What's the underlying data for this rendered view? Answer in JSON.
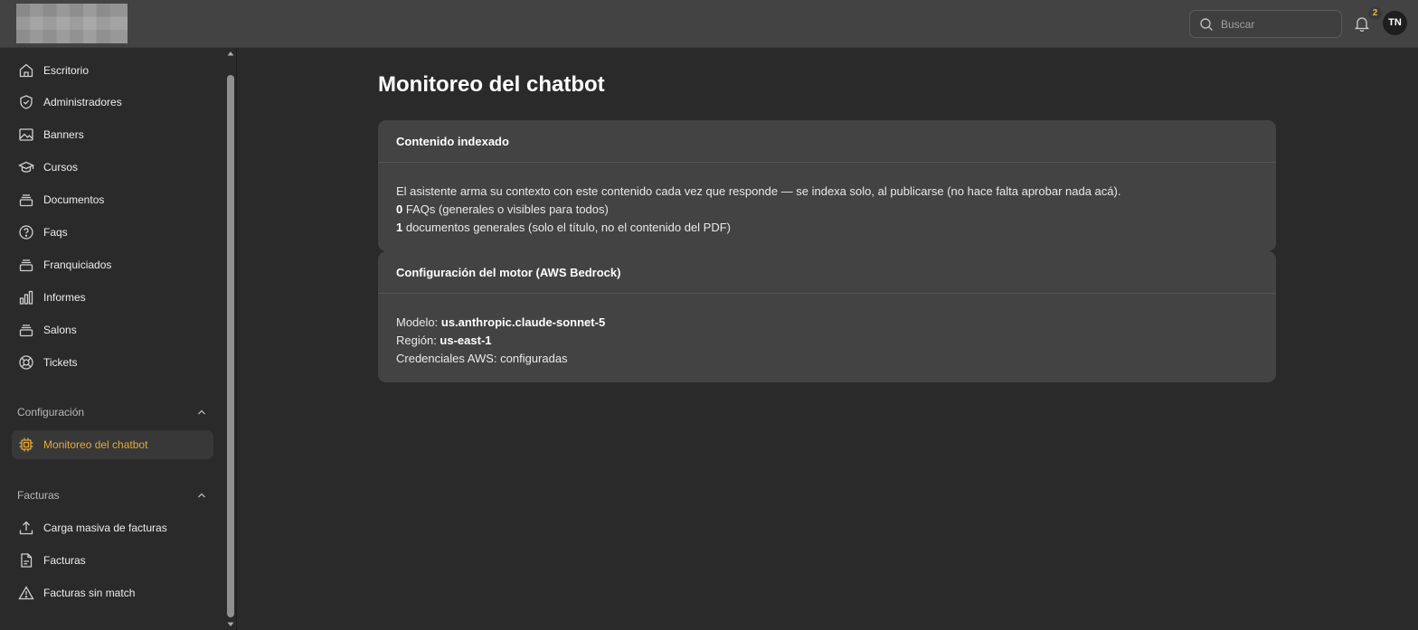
{
  "search": {
    "placeholder": "Buscar"
  },
  "notifications": {
    "count": "2"
  },
  "user": {
    "initials": "TN"
  },
  "sidebar": {
    "items": [
      {
        "label": "Escritorio",
        "icon": "home-icon"
      },
      {
        "label": "Administradores",
        "icon": "shield-check-icon"
      },
      {
        "label": "Banners",
        "icon": "image-icon"
      },
      {
        "label": "Cursos",
        "icon": "graduation-cap-icon"
      },
      {
        "label": "Documentos",
        "icon": "folder-stack-icon"
      },
      {
        "label": "Faqs",
        "icon": "help-circle-icon"
      },
      {
        "label": "Franquiciados",
        "icon": "folder-stack-icon"
      },
      {
        "label": "Informes",
        "icon": "bar-chart-icon"
      },
      {
        "label": "Salons",
        "icon": "folder-stack-icon"
      },
      {
        "label": "Tickets",
        "icon": "lifebuoy-icon"
      }
    ],
    "sections": [
      {
        "label": "Configuración",
        "items": [
          {
            "label": "Monitoreo del chatbot",
            "icon": "cpu-chip-icon",
            "active": true
          }
        ]
      },
      {
        "label": "Facturas",
        "items": [
          {
            "label": "Carga masiva de facturas",
            "icon": "upload-icon"
          },
          {
            "label": "Facturas",
            "icon": "document-icon"
          },
          {
            "label": "Facturas sin match",
            "icon": "alert-triangle-icon"
          }
        ]
      }
    ]
  },
  "main": {
    "title": "Monitoreo del chatbot",
    "cards": [
      {
        "header": "Contenido indexado",
        "description": "El asistente arma su contexto con este contenido cada vez que responde — se indexa solo, al publicarse (no hace falta aprobar nada acá).",
        "faqs_count": "0",
        "faqs_text": " FAQs (generales o visibles para todos)",
        "docs_count": "1",
        "docs_text": " documentos generales (solo el título, no el contenido del PDF)"
      },
      {
        "header": "Configuración del motor (AWS Bedrock)",
        "model_label": "Modelo: ",
        "model_value": "us.anthropic.claude-sonnet-5",
        "region_label": "Región: ",
        "region_value": "us-east-1",
        "credentials": "Credenciales AWS: configuradas"
      }
    ]
  },
  "colors": {
    "accent": "#e5a93a",
    "background": "#2a2a2a",
    "card": "#434343",
    "topbar": "#434343"
  }
}
